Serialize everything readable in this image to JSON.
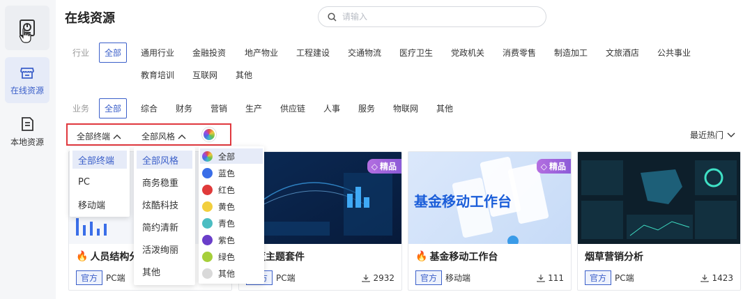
{
  "sidebar": {
    "items": [
      {
        "label": "",
        "icon": "dashboard-file-icon"
      },
      {
        "label": "在线资源",
        "icon": "store-icon"
      },
      {
        "label": "本地资源",
        "icon": "document-icon"
      }
    ]
  },
  "header": {
    "title": "在线资源",
    "search_placeholder": "请输入"
  },
  "industry": {
    "label": "行业",
    "tags": [
      "全部",
      "通用行业",
      "金融投资",
      "地产物业",
      "工程建设",
      "交通物流",
      "医疗卫生",
      "党政机关",
      "消费零售",
      "制造加工",
      "文旅酒店",
      "公共事业",
      "教育培训",
      "互联网",
      "其他"
    ]
  },
  "business": {
    "label": "业务",
    "tags": [
      "全部",
      "综合",
      "财务",
      "营销",
      "生产",
      "供应链",
      "人事",
      "服务",
      "物联网",
      "其他"
    ]
  },
  "filters": {
    "terminal": "全部终端",
    "style": "全部风格",
    "sort": "最近热门"
  },
  "terminal_menu": [
    "全部终端",
    "PC",
    "移动端"
  ],
  "style_menu": [
    "全部风格",
    "商务稳重",
    "炫酷科技",
    "简约清新",
    "活泼绚丽",
    "其他"
  ],
  "color_menu": [
    {
      "label": "全部",
      "color": "rainbow"
    },
    {
      "label": "蓝色",
      "color": "#3a6ee8"
    },
    {
      "label": "红色",
      "color": "#e03a3a"
    },
    {
      "label": "黄色",
      "color": "#f2cf3e"
    },
    {
      "label": "青色",
      "color": "#4bbdc2"
    },
    {
      "label": "紫色",
      "color": "#6a3ec9"
    },
    {
      "label": "绿色",
      "color": "#a6cf3a"
    },
    {
      "label": "其他",
      "color": "#d9d9d9"
    }
  ],
  "cards": [
    {
      "title": "人员结构分",
      "hot": true,
      "official": "官方",
      "platform": "PC端",
      "downloads": "",
      "premium": false
    },
    {
      "title": "蹦蓝主题套件",
      "hot": false,
      "official": "官方",
      "platform": "PC端",
      "downloads": "2932",
      "premium": true,
      "premium_label": "精品"
    },
    {
      "title": "基金移动工作台",
      "hot": true,
      "official": "官方",
      "platform": "移动端",
      "downloads": "111",
      "premium": true,
      "premium_label": "精品",
      "thumb_text": "基金移动工作台"
    },
    {
      "title": "烟草营销分析",
      "hot": false,
      "official": "官方",
      "platform": "PC端",
      "downloads": "1423",
      "premium": false
    }
  ],
  "colors": {
    "accent": "#3b5fc9",
    "highlight": "#e0383e",
    "premium": "#9b5de5",
    "hot": "#ff6a1a"
  }
}
